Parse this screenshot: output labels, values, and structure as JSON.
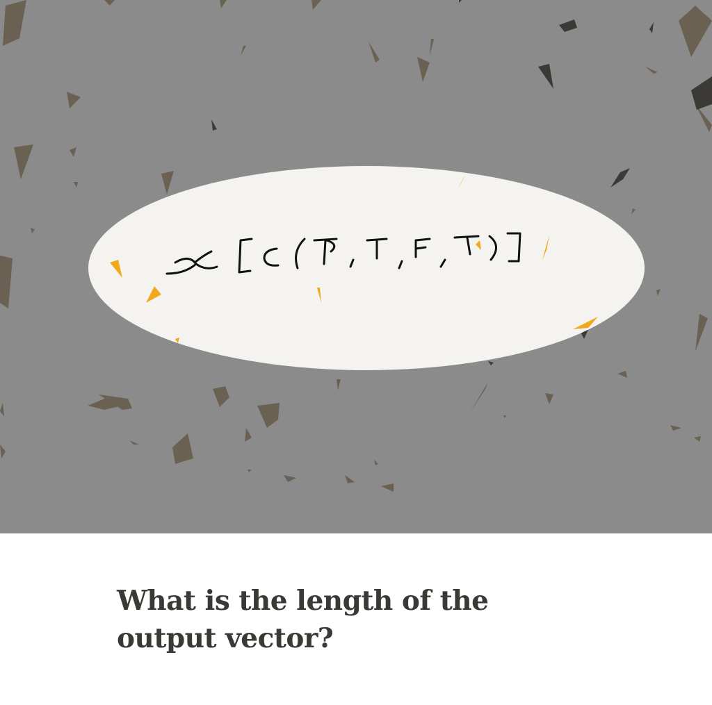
{
  "handwritten_expression": "x[c(T, T, F, T)]",
  "question": "What is the length of the output vector?",
  "colors": {
    "background": "#8b8b8b",
    "ellipse": "#f4f3f0",
    "confetti_brown": "#6b6153",
    "confetti_dark": "#3b3a36",
    "confetti_orange": "#f2a81d",
    "question_text": "#3a3935"
  }
}
